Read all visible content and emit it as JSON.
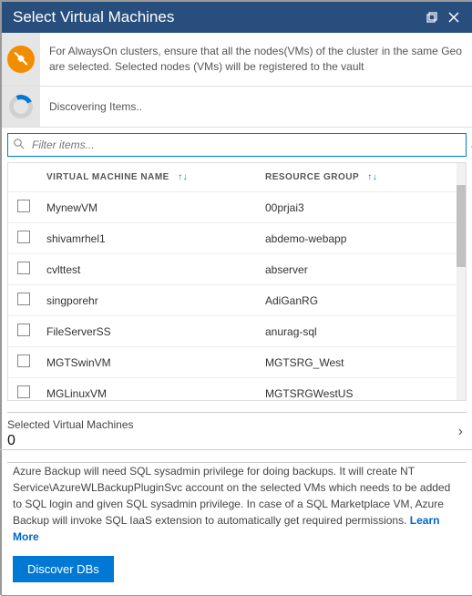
{
  "titlebar": {
    "title": "Select Virtual Machines"
  },
  "info_banner": {
    "text": "For AlwaysOn clusters, ensure that all the nodes(VMs) of the cluster in the same Geo are selected. Selected nodes (VMs) will be registered to the vault"
  },
  "discover_banner": {
    "text": "Discovering Items.."
  },
  "filter": {
    "placeholder": "Filter items..."
  },
  "table": {
    "headers": {
      "name": "VIRTUAL MACHINE NAME",
      "rg": "RESOURCE GROUP"
    },
    "rows": [
      {
        "name": "MynewVM",
        "rg": "00prjai3"
      },
      {
        "name": "shivamrhel1",
        "rg": "abdemo-webapp"
      },
      {
        "name": "cvlttest",
        "rg": "abserver"
      },
      {
        "name": "singporehr",
        "rg": "AdiGanRG"
      },
      {
        "name": "FileServerSS",
        "rg": "anurag-sql"
      },
      {
        "name": "MGTSwinVM",
        "rg": "MGTSRG_West"
      },
      {
        "name": "MGLinuxVM",
        "rg": "MGTSRGWestUS"
      }
    ]
  },
  "selected": {
    "label": "Selected Virtual Machines",
    "count": "0"
  },
  "footer": {
    "text": "Azure Backup will need SQL sysadmin privilege for doing backups. It will create NT Service\\AzureWLBackupPluginSvc account on the selected VMs which needs to be added to SQL login and given SQL sysadmin privilege. In case of a SQL Marketplace VM, Azure Backup will invoke SQL IaaS extension to automatically get required permissions. ",
    "learn_more": "Learn More",
    "button": "Discover DBs"
  }
}
